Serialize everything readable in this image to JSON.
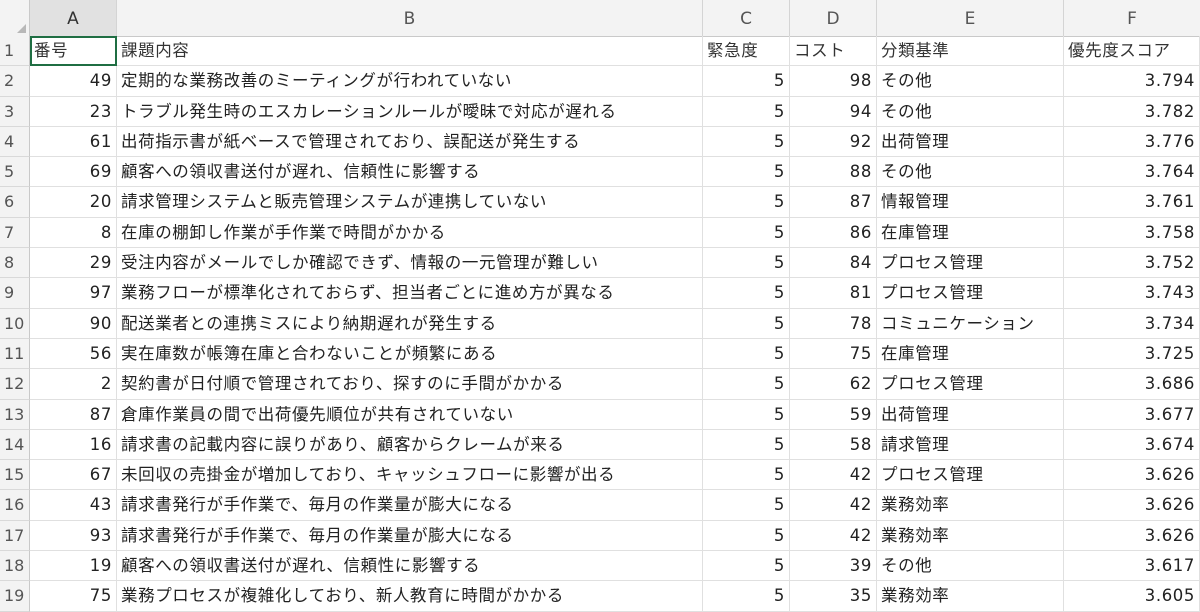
{
  "columns": [
    "A",
    "B",
    "C",
    "D",
    "E",
    "F"
  ],
  "headers": {
    "a": "番号",
    "b": "課題内容",
    "c": "緊急度",
    "d": "コスト",
    "e": "分類基準",
    "f": "優先度スコア"
  },
  "row_numbers": [
    "1",
    "2",
    "3",
    "4",
    "5",
    "6",
    "7",
    "8",
    "9",
    "10",
    "11",
    "12",
    "13",
    "14",
    "15",
    "16",
    "17",
    "18",
    "19"
  ],
  "rows": [
    {
      "a": "49",
      "b": "定期的な業務改善のミーティングが行われていない",
      "c": "5",
      "d": "98",
      "e": "その他",
      "f": "3.794"
    },
    {
      "a": "23",
      "b": "トラブル発生時のエスカレーションルールが曖昧で対応が遅れる",
      "c": "5",
      "d": "94",
      "e": "その他",
      "f": "3.782"
    },
    {
      "a": "61",
      "b": "出荷指示書が紙ベースで管理されており、誤配送が発生する",
      "c": "5",
      "d": "92",
      "e": "出荷管理",
      "f": "3.776"
    },
    {
      "a": "69",
      "b": "顧客への領収書送付が遅れ、信頼性に影響する",
      "c": "5",
      "d": "88",
      "e": "その他",
      "f": "3.764"
    },
    {
      "a": "20",
      "b": "請求管理システムと販売管理システムが連携していない",
      "c": "5",
      "d": "87",
      "e": "情報管理",
      "f": "3.761"
    },
    {
      "a": "8",
      "b": "在庫の棚卸し作業が手作業で時間がかかる",
      "c": "5",
      "d": "86",
      "e": "在庫管理",
      "f": "3.758"
    },
    {
      "a": "29",
      "b": "受注内容がメールでしか確認できず、情報の一元管理が難しい",
      "c": "5",
      "d": "84",
      "e": "プロセス管理",
      "f": "3.752"
    },
    {
      "a": "97",
      "b": "業務フローが標準化されておらず、担当者ごとに進め方が異なる",
      "c": "5",
      "d": "81",
      "e": "プロセス管理",
      "f": "3.743"
    },
    {
      "a": "90",
      "b": "配送業者との連携ミスにより納期遅れが発生する",
      "c": "5",
      "d": "78",
      "e": "コミュニケーション",
      "f": "3.734"
    },
    {
      "a": "56",
      "b": "実在庫数が帳簿在庫と合わないことが頻繁にある",
      "c": "5",
      "d": "75",
      "e": "在庫管理",
      "f": "3.725"
    },
    {
      "a": "2",
      "b": "契約書が日付順で管理されており、探すのに手間がかかる",
      "c": "5",
      "d": "62",
      "e": "プロセス管理",
      "f": "3.686"
    },
    {
      "a": "87",
      "b": "倉庫作業員の間で出荷優先順位が共有されていない",
      "c": "5",
      "d": "59",
      "e": "出荷管理",
      "f": "3.677"
    },
    {
      "a": "16",
      "b": "請求書の記載内容に誤りがあり、顧客からクレームが来る",
      "c": "5",
      "d": "58",
      "e": "請求管理",
      "f": "3.674"
    },
    {
      "a": "67",
      "b": "未回収の売掛金が増加しており、キャッシュフローに影響が出る",
      "c": "5",
      "d": "42",
      "e": "プロセス管理",
      "f": "3.626"
    },
    {
      "a": "43",
      "b": "請求書発行が手作業で、毎月の作業量が膨大になる",
      "c": "5",
      "d": "42",
      "e": "業務効率",
      "f": "3.626"
    },
    {
      "a": "93",
      "b": "請求書発行が手作業で、毎月の作業量が膨大になる",
      "c": "5",
      "d": "42",
      "e": "業務効率",
      "f": "3.626"
    },
    {
      "a": "19",
      "b": "顧客への領収書送付が遅れ、信頼性に影響する",
      "c": "5",
      "d": "39",
      "e": "その他",
      "f": "3.617"
    },
    {
      "a": "75",
      "b": "業務プロセスが複雑化しており、新人教育に時間がかかる",
      "c": "5",
      "d": "35",
      "e": "業務効率",
      "f": "3.605"
    }
  ]
}
